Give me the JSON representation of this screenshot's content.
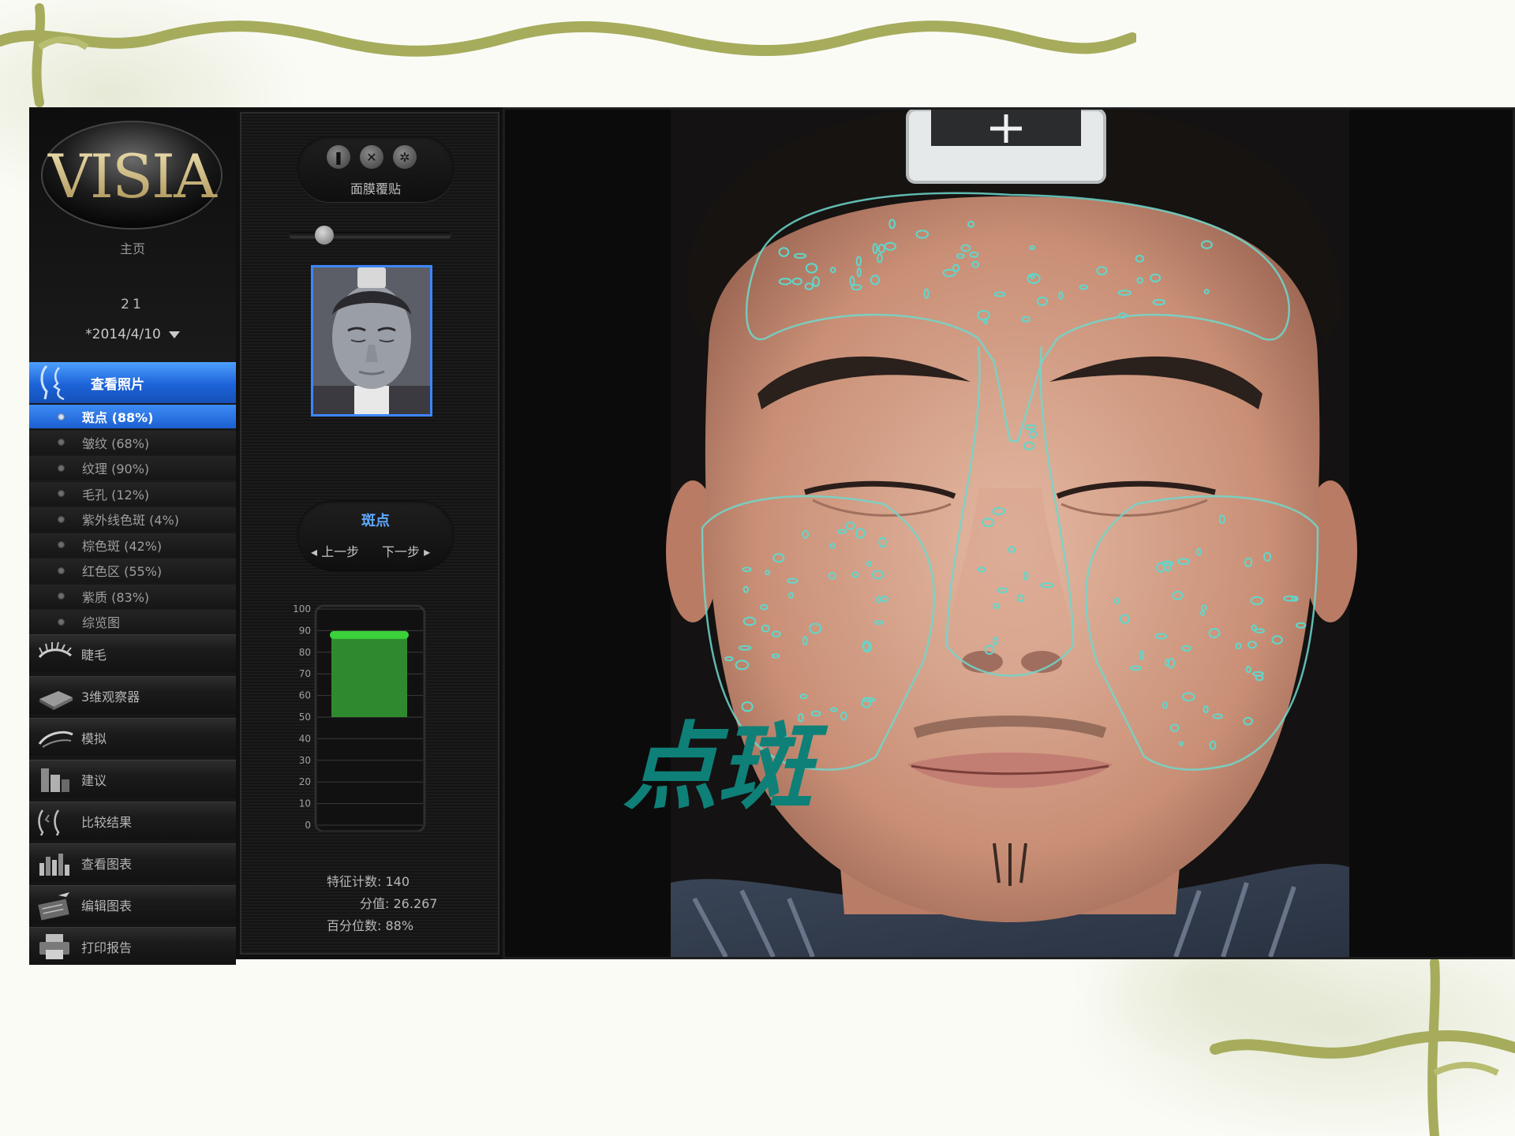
{
  "app": {
    "logo_text": "VISIA",
    "home_label": "主页",
    "client_count": "21",
    "session_date": "*2014/4/10"
  },
  "sidebar": {
    "view_photos_label": "查看照片",
    "sub_items": [
      {
        "label": "斑点 (88%)",
        "active": true
      },
      {
        "label": "皱纹 (68%)",
        "active": false
      },
      {
        "label": "纹理 (90%)",
        "active": false
      },
      {
        "label": "毛孔 (12%)",
        "active": false
      },
      {
        "label": "紫外线色斑 (4%)",
        "active": false
      },
      {
        "label": "棕色斑 (42%)",
        "active": false
      },
      {
        "label": "红色区 (55%)",
        "active": false
      },
      {
        "label": "紫质 (83%)",
        "active": false
      },
      {
        "label": "综览图",
        "active": false
      }
    ],
    "nav_items": [
      {
        "label": "睫毛",
        "icon": "eyelash-icon"
      },
      {
        "label": "3维观察器",
        "icon": "3d-viewer-icon"
      },
      {
        "label": "模拟",
        "icon": "simulation-icon"
      },
      {
        "label": "建议",
        "icon": "recommendation-icon"
      },
      {
        "label": "比较结果",
        "icon": "compare-icon"
      },
      {
        "label": "查看图表",
        "icon": "chart-icon"
      },
      {
        "label": "编辑图表",
        "icon": "edit-chart-icon"
      },
      {
        "label": "打印报告",
        "icon": "printer-icon"
      }
    ]
  },
  "mask_control": {
    "label": "面膜覆贴",
    "buttons": [
      "show-mask-icon",
      "close-icon",
      "settings-icon"
    ]
  },
  "opacity_slider": {
    "value": 0.18
  },
  "feature_nav": {
    "title": "斑点",
    "prev_label": "上一步",
    "next_label": "下一步"
  },
  "percentile_meter": {
    "ticks": [
      "100",
      "90",
      "80",
      "70",
      "60",
      "50",
      "40",
      "30",
      "20",
      "10",
      "0"
    ],
    "value": 88,
    "max": 100,
    "fill_color": "#2f8a2f",
    "marker_color": "#3ad13a"
  },
  "stats": {
    "feature_count_label": "特征计数:",
    "feature_count": "140",
    "score_label": "分值:",
    "score": "26.267",
    "percentile_label": "百分位数:",
    "percentile": "88%"
  },
  "overlay": {
    "caption": "点斑",
    "caption_color": "#0e8078",
    "spot_color": "#5ed8cc"
  }
}
